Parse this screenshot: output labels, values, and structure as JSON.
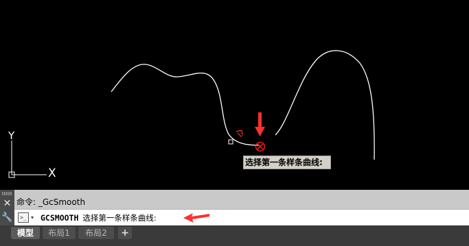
{
  "tooltip": {
    "text": "选择第一条样条曲线:"
  },
  "command_history": {
    "text": "命令: _GcSmooth"
  },
  "command_line": {
    "command": "GCSMOOTH",
    "prompt": "选择第一条样条曲线:"
  },
  "ucs_axes": {
    "x_label": "X",
    "y_label": "Y"
  },
  "tabs": [
    {
      "label": "模型",
      "active": true
    },
    {
      "label": "布局1",
      "active": false
    },
    {
      "label": "布局2",
      "active": false
    }
  ],
  "add_tab": {
    "label": "+"
  },
  "colors": {
    "canvas": "#000000",
    "curve": "#ffffff",
    "marker": "#ff2020",
    "annotation": "#ff3030"
  },
  "icons": [
    "close-icon",
    "wrench-icon",
    "terminal-prompt-icon",
    "dropdown-arrow-icon"
  ]
}
